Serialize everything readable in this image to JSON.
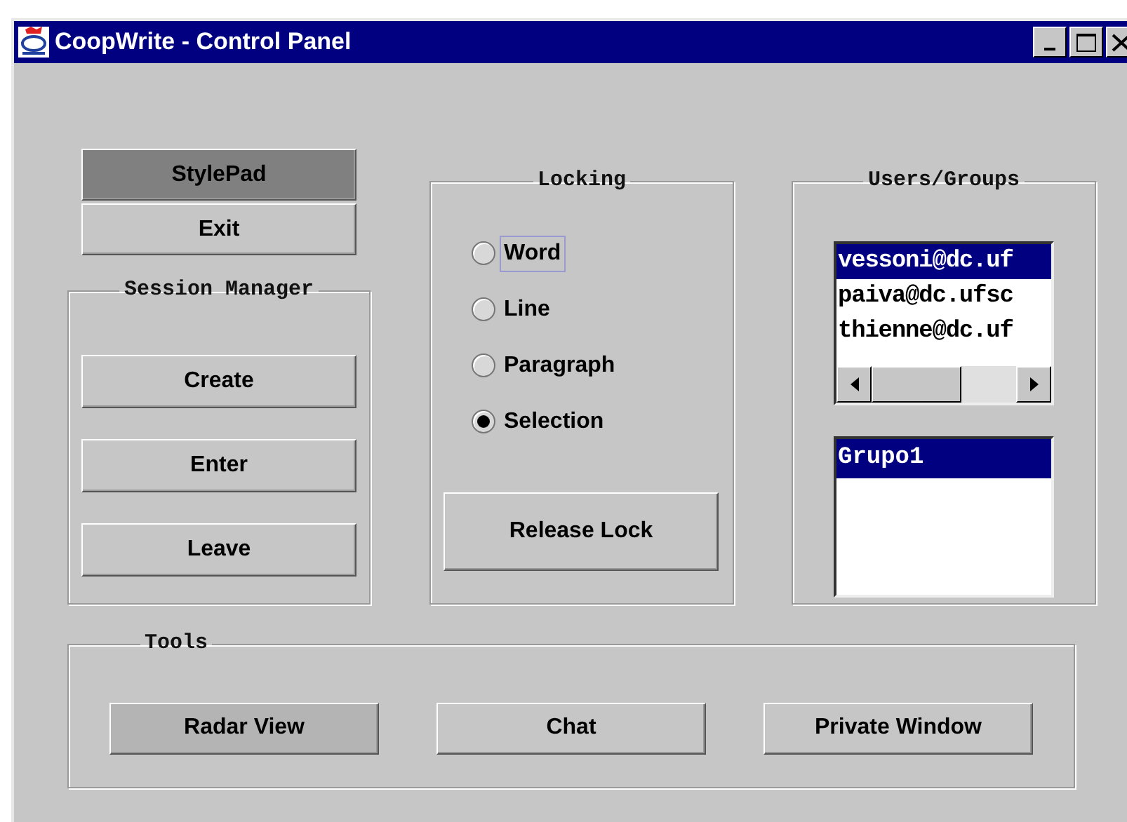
{
  "window": {
    "title": "CoopWrite - Control Panel"
  },
  "top_buttons": [
    {
      "label": "StylePad",
      "pressed": true
    },
    {
      "label": "Exit",
      "pressed": false
    }
  ],
  "session_manager": {
    "title": "Session Manager",
    "buttons": [
      "Create",
      "Enter",
      "Leave"
    ]
  },
  "locking": {
    "title": "Locking",
    "options": [
      {
        "label": "Word",
        "selected": false,
        "focused": true
      },
      {
        "label": "Line",
        "selected": false,
        "focused": false
      },
      {
        "label": "Paragraph",
        "selected": false,
        "focused": false
      },
      {
        "label": "Selection",
        "selected": true,
        "focused": false
      }
    ],
    "release_button": "Release Lock"
  },
  "users_groups": {
    "title": "Users/Groups",
    "users": [
      {
        "name": "vessoni@dc.uf",
        "selected": true
      },
      {
        "name": "paiva@dc.ufsc",
        "selected": false
      },
      {
        "name": "thienne@dc.uf",
        "selected": false
      }
    ],
    "groups": [
      {
        "name": "Grupo1",
        "selected": true
      }
    ]
  },
  "tools": {
    "title": "Tools",
    "buttons": [
      {
        "label": "Radar View",
        "hovered": true
      },
      {
        "label": "Chat",
        "hovered": false
      },
      {
        "label": "Private Window",
        "hovered": false
      }
    ]
  }
}
